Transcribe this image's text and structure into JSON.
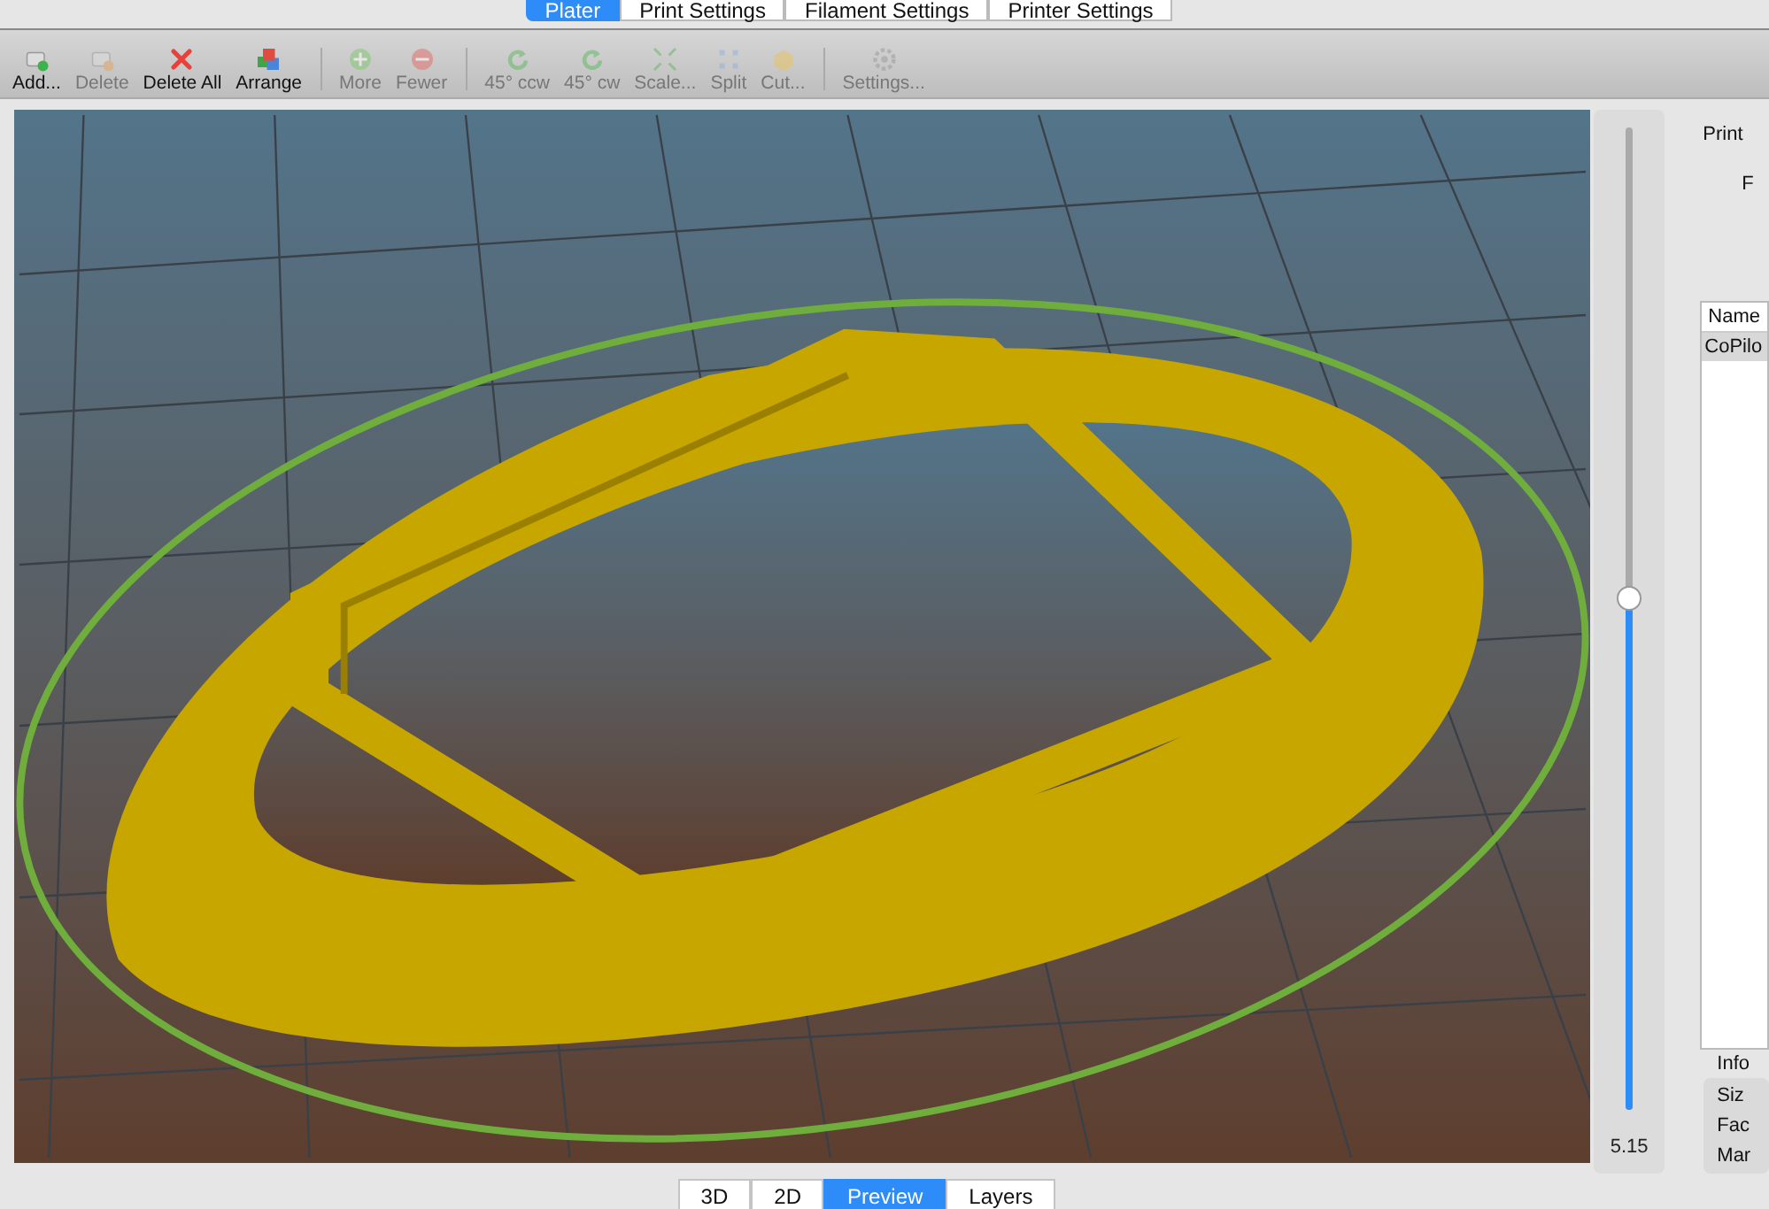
{
  "tabs": [
    {
      "label": "Plater",
      "selected": true
    },
    {
      "label": "Print Settings",
      "selected": false
    },
    {
      "label": "Filament Settings",
      "selected": false
    },
    {
      "label": "Printer Settings",
      "selected": false
    }
  ],
  "toolbar": [
    {
      "label": "Add...",
      "kind": "add",
      "disabled": false
    },
    {
      "label": "Delete",
      "kind": "delete",
      "disabled": true
    },
    {
      "label": "Delete All",
      "kind": "delete-all",
      "disabled": false
    },
    {
      "label": "Arrange",
      "kind": "arrange",
      "disabled": false
    },
    {
      "kind": "separator"
    },
    {
      "label": "More",
      "kind": "more",
      "disabled": true
    },
    {
      "label": "Fewer",
      "kind": "fewer",
      "disabled": true
    },
    {
      "kind": "separator"
    },
    {
      "label": "45° ccw",
      "kind": "ccw",
      "disabled": true
    },
    {
      "label": "45° cw",
      "kind": "cw",
      "disabled": true
    },
    {
      "label": "Scale...",
      "kind": "scale",
      "disabled": true
    },
    {
      "label": "Split",
      "kind": "split",
      "disabled": true
    },
    {
      "label": "Cut...",
      "kind": "cut",
      "disabled": true
    },
    {
      "kind": "separator"
    },
    {
      "label": "Settings...",
      "kind": "settings",
      "disabled": true
    }
  ],
  "layer_slider": {
    "level": 0.52,
    "reading": "5.15"
  },
  "right_panel": {
    "print_label": "Print",
    "f_label": "F",
    "objects": {
      "columns": [
        "Name"
      ],
      "rows": [
        {
          "name": "CoPilo",
          "selected": true
        }
      ]
    },
    "info": {
      "title": "Info",
      "rows": [
        "Siz",
        "Fac",
        "Mar"
      ]
    }
  },
  "view_tabs": [
    {
      "label": "3D",
      "selected": false
    },
    {
      "label": "2D",
      "selected": false
    },
    {
      "label": "Preview",
      "selected": true
    },
    {
      "label": "Layers",
      "selected": false
    }
  ]
}
